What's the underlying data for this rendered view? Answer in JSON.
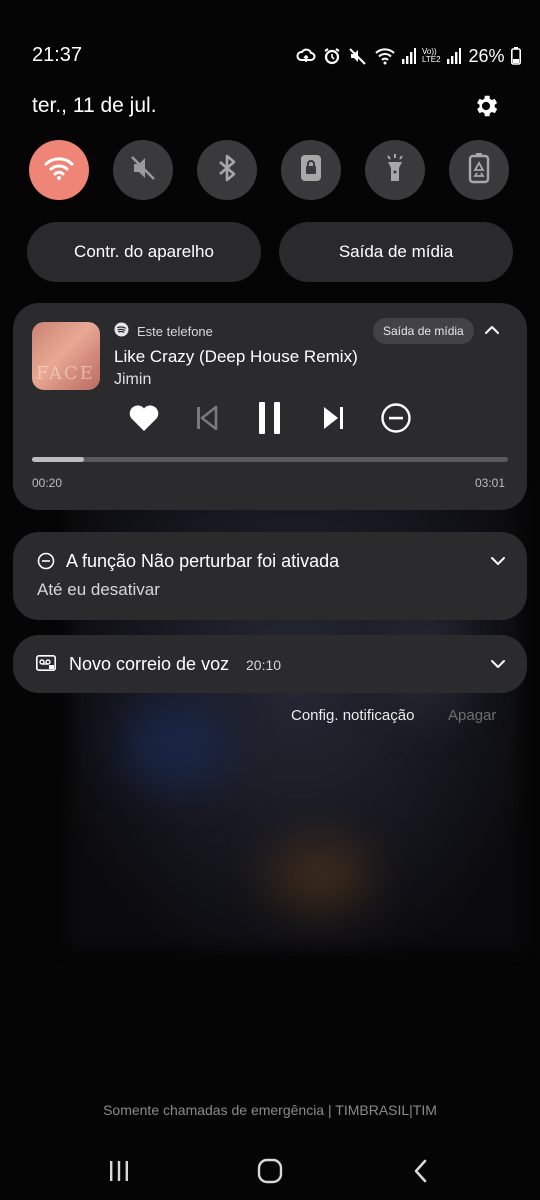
{
  "status_bar": {
    "time": "21:37",
    "battery_percent": "26%",
    "icons": [
      "sync-icon",
      "alarm-icon",
      "mute-icon",
      "wifi-icon",
      "signal-icon",
      "volte-icon",
      "signal-icon",
      "battery-icon"
    ],
    "volte_label_top": "Vo))",
    "volte_label_bottom": "LTE2"
  },
  "panel": {
    "date": "ter., 11 de jul.",
    "quick_settings": [
      {
        "name": "wifi",
        "state": "on"
      },
      {
        "name": "sound-mute",
        "state": "off"
      },
      {
        "name": "bluetooth",
        "state": "off"
      },
      {
        "name": "screen-lock",
        "state": "off"
      },
      {
        "name": "flashlight",
        "state": "off"
      },
      {
        "name": "power-saving",
        "state": "off"
      }
    ],
    "device_controls_label": "Contr. do aparelho",
    "media_output_label": "Saída de mídia"
  },
  "media": {
    "source": "Este telefone",
    "output_button": "Saída de mídia",
    "title": "Like Crazy (Deep House Remix)",
    "artist": "Jimin",
    "art_text": "FACE",
    "elapsed": "00:20",
    "duration": "03:01",
    "progress_fraction": 0.11
  },
  "notifications": {
    "dnd": {
      "title": "A função Não perturbar foi ativada",
      "subtitle": "Até eu desativar"
    },
    "voicemail": {
      "title": "Novo correio de voz",
      "time": "20:10"
    },
    "settings_link": "Config. notificação",
    "clear_link": "Apagar"
  },
  "footer": {
    "carrier_text": "Somente chamadas de emergência | TIMBRASIL|TIM"
  },
  "colors": {
    "accent_wifi": "#ef8576",
    "card_bg": "#2b2b2d",
    "tile_bg": "#3a3a3c"
  }
}
